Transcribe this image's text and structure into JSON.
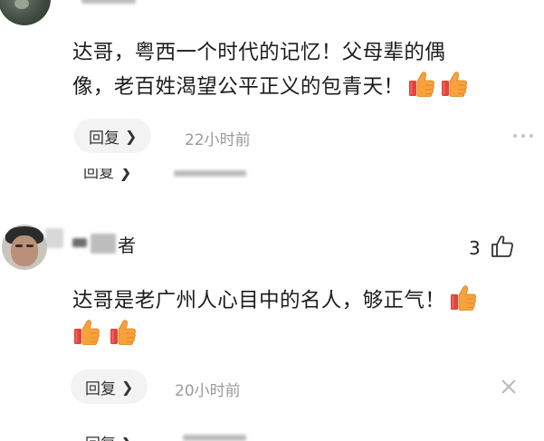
{
  "comment_top": {
    "text_line1": "达哥，粤西一个时代的记忆！父母辈的偶",
    "text_line2": "像，老百姓渴望公平正义的包青天！",
    "reply_label": "回复",
    "timestamp": "22小时前",
    "thumb_icons": [
      "thumbs-up-emoji",
      "thumbs-up-emoji"
    ]
  },
  "sub_reply_top": {
    "reply_label": "回复"
  },
  "comment_second": {
    "username_partial": "者",
    "like_count": "3",
    "text_line1": "达哥是老广州人心目中的名人，够正气！",
    "reply_label": "回复",
    "timestamp": "20小时前",
    "thumb_icons": [
      "thumbs-up-emoji",
      "thumbs-up-emoji",
      "thumbs-up-emoji"
    ]
  },
  "sub_reply_bottom": {
    "reply_label": "回复"
  },
  "colors": {
    "emoji_thumb": "#f7a23b",
    "emoji_cuff": "#e2433b",
    "reply_bg": "#f3f3f3",
    "muted_text": "#9a9a9a"
  }
}
